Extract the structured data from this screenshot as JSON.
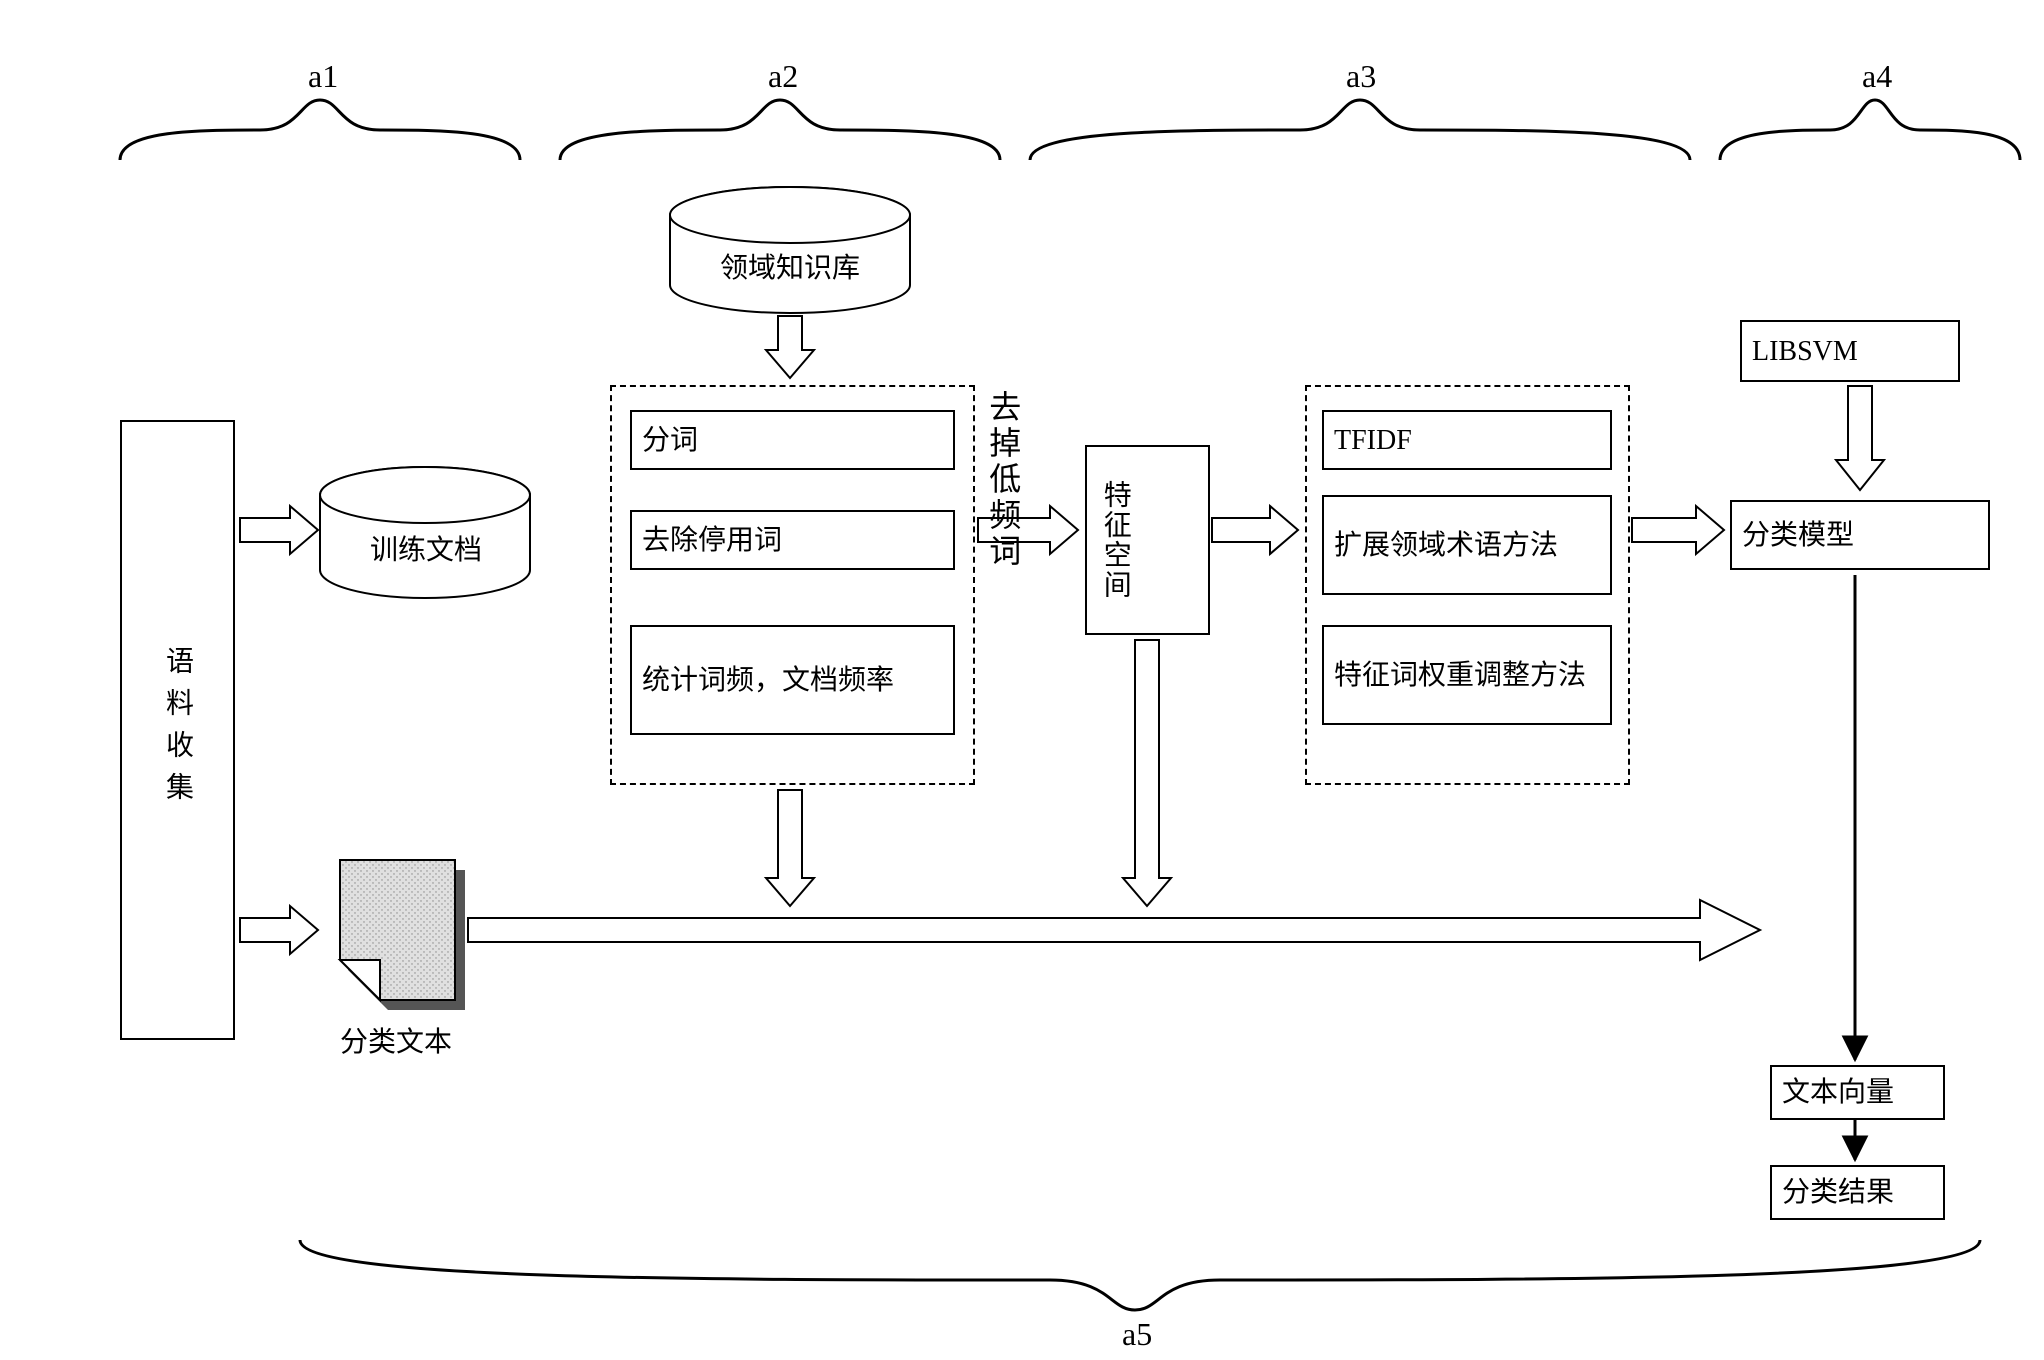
{
  "sections": {
    "a1": "a1",
    "a2": "a2",
    "a3": "a3",
    "a4": "a4",
    "a5": "a5"
  },
  "corpus_block": "语料收集",
  "train_doc_cyl": "训练文档",
  "classify_text_label": "分类文本",
  "kb_cyl": "领域知识库",
  "a2_boxes": {
    "segment": "分词",
    "stopwords": "去除停用词",
    "stats": "统计词频，文档频率"
  },
  "remove_lowfreq": "去掉低频词",
  "feature_space": "特征空间",
  "a3_boxes": {
    "tfidf": "TFIDF",
    "ext_domain": "扩展领域术语方法",
    "weight_adj": "特征词权重调整方法"
  },
  "libsvm": "LIBSVM",
  "class_model": "分类模型",
  "text_vector": "文本向量",
  "class_result": "分类结果"
}
